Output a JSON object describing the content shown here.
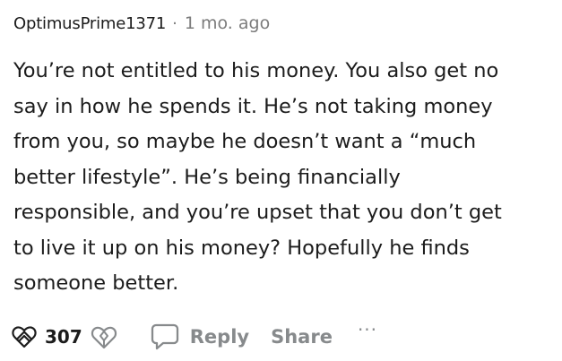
{
  "comment": {
    "author": "OptimusPrime1371",
    "separator": "·",
    "timestamp": "1 mo. ago",
    "body": "You’re not entitled to his money. You also get no\nsay in how he spends it. He’s not taking money\nfrom you, so maybe he doesn’t want a “much\nbetter lifestyle”. He’s being financially\nresponsible, and you’re upset that you don’t get\nto live it up on his money? Hopefully he finds\nsomeone better.",
    "actions": {
      "vote_count": "307",
      "reply_label": "Reply",
      "share_label": "Share",
      "more_label": "···"
    },
    "icons": {
      "upvote": "heart-upvote-icon",
      "downvote": "heart-downvote-icon",
      "reply": "speech-bubble-icon",
      "more": "more-options-icon"
    },
    "colors": {
      "text": "#1c1c1c",
      "muted": "#7c7c7c",
      "action": "#878a8c"
    }
  }
}
